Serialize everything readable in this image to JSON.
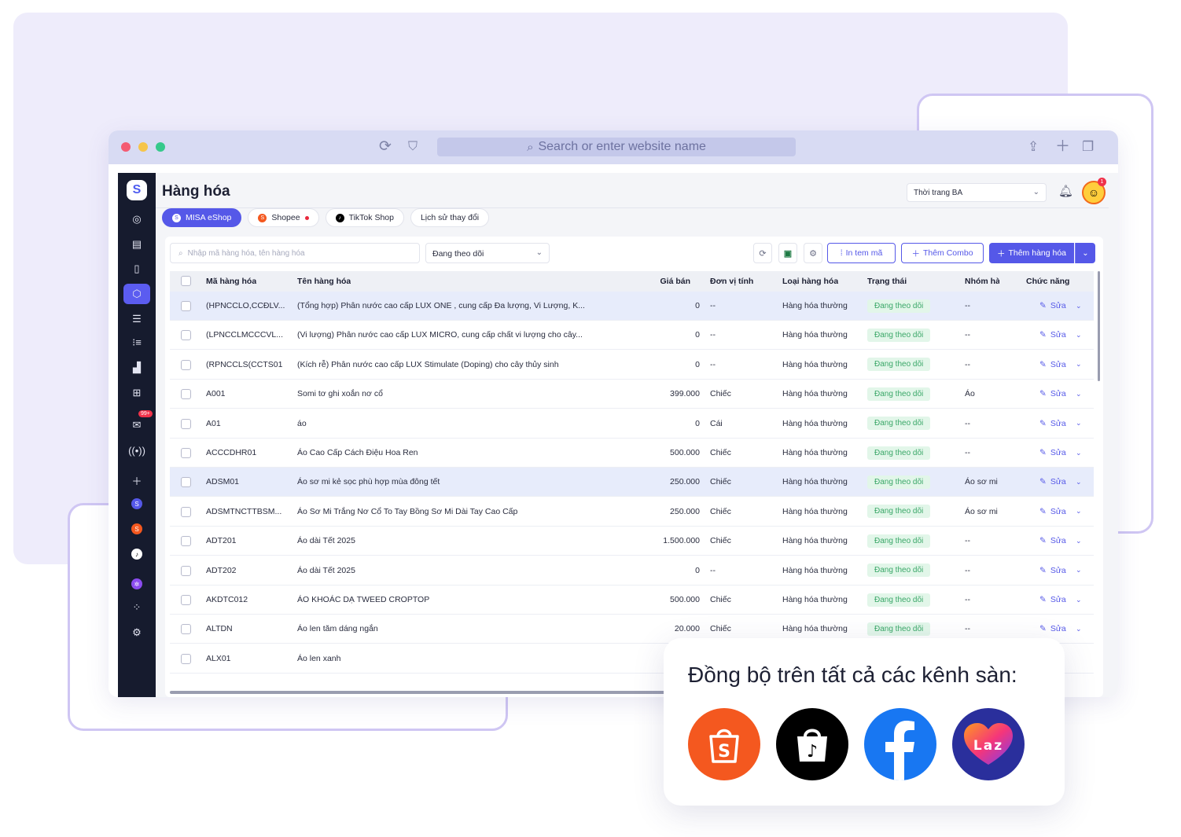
{
  "browser": {
    "url_placeholder": "Search or enter website name",
    "reload_icon": "reload-icon",
    "shield_icon": "shield-icon",
    "share_icon": "share-icon",
    "new_tab_icon": "plus-icon",
    "tabs_icon": "tabs-icon"
  },
  "header": {
    "title": "Hàng hóa",
    "shop_select": "Thời trang BA",
    "avatar_badge": "1"
  },
  "sidebar": {
    "logo_letter": "S",
    "message_badge": "99+"
  },
  "tabs": [
    {
      "label": "MISA eShop",
      "active": true
    },
    {
      "label": "Shopee",
      "active": false
    },
    {
      "label": "TikTok Shop",
      "active": false
    },
    {
      "label": "Lịch sử thay đổi",
      "active": false
    }
  ],
  "toolbar": {
    "search_placeholder": "Nhập mã hàng hóa, tên hàng hóa",
    "follow_filter": "Đang theo dõi",
    "print_label": "In tem mã",
    "combo_label": "Thêm Combo",
    "add_label": "Thêm hàng hóa"
  },
  "table": {
    "headers": {
      "code": "Mã hàng hóa",
      "name": "Tên hàng hóa",
      "price": "Giá bán",
      "unit": "Đơn vị tính",
      "type": "Loại hàng hóa",
      "status": "Trạng thái",
      "group": "Nhóm hà",
      "actions": "Chức năng"
    },
    "edit_label": "Sửa",
    "rows": [
      {
        "code": "(HPNCCLO,CCĐLV...",
        "name": "(Tổng hợp) Phân nước cao cấp LUX ONE , cung cấp Đa lượng, Vi Lượng, K...",
        "price": "0",
        "unit": "--",
        "type": "Hàng hóa thường",
        "status": "Đang theo dõi",
        "group": "--",
        "highlight": true
      },
      {
        "code": "(LPNCCLMCCCVL...",
        "name": "(Vi lượng) Phân nước cao cấp LUX MICRO, cung cấp chất vi lượng cho cây...",
        "price": "0",
        "unit": "--",
        "type": "Hàng hóa thường",
        "status": "Đang theo dõi",
        "group": "--",
        "highlight": false
      },
      {
        "code": "(RPNCCLS(CCTS01",
        "name": "(Kích rễ) Phân nước cao cấp LUX Stimulate (Doping) cho cây thủy sinh",
        "price": "0",
        "unit": "--",
        "type": "Hàng hóa thường",
        "status": "Đang theo dõi",
        "group": "--",
        "highlight": false
      },
      {
        "code": "A001",
        "name": "Somi tơ ghi xoắn nơ cổ",
        "price": "399.000",
        "unit": "Chiếc",
        "type": "Hàng hóa thường",
        "status": "Đang theo dõi",
        "group": "Áo",
        "highlight": false
      },
      {
        "code": "A01",
        "name": "áo",
        "price": "0",
        "unit": "Cái",
        "type": "Hàng hóa thường",
        "status": "Đang theo dõi",
        "group": "--",
        "highlight": false
      },
      {
        "code": "ACCCDHR01",
        "name": "Áo Cao Cấp Cách Điệu Hoa Ren",
        "price": "500.000",
        "unit": "Chiếc",
        "type": "Hàng hóa thường",
        "status": "Đang theo dõi",
        "group": "--",
        "highlight": false
      },
      {
        "code": "ADSM01",
        "name": "Áo sơ mi kẻ sọc phù hợp mùa đông tết",
        "price": "250.000",
        "unit": "Chiếc",
        "type": "Hàng hóa thường",
        "status": "Đang theo dõi",
        "group": "Áo sơ mi",
        "highlight": true
      },
      {
        "code": "ADSMTNCTTBSM...",
        "name": "Áo Sơ Mi Trắng Nơ Cổ To Tay Bồng Sơ Mi Dài Tay Cao Cấp",
        "price": "250.000",
        "unit": "Chiếc",
        "type": "Hàng hóa thường",
        "status": "Đang theo dõi",
        "group": "Áo sơ mi",
        "highlight": false
      },
      {
        "code": "ADT201",
        "name": "Áo dài Tết 2025",
        "price": "1.500.000",
        "unit": "Chiếc",
        "type": "Hàng hóa thường",
        "status": "Đang theo dõi",
        "group": "--",
        "highlight": false
      },
      {
        "code": "ADT202",
        "name": "Áo dài Tết 2025",
        "price": "0",
        "unit": "--",
        "type": "Hàng hóa thường",
        "status": "Đang theo dõi",
        "group": "--",
        "highlight": false
      },
      {
        "code": "AKDTC012",
        "name": "ÁO KHOÁC DẠ TWEED CROPTOP",
        "price": "500.000",
        "unit": "Chiếc",
        "type": "Hàng hóa thường",
        "status": "Đang theo dõi",
        "group": "--",
        "highlight": false
      },
      {
        "code": "ALTDN",
        "name": "Áo len tăm dáng ngắn",
        "price": "20.000",
        "unit": "Chiếc",
        "type": "Hàng hóa thường",
        "status": "Đang theo dõi",
        "group": "--",
        "highlight": false
      },
      {
        "code": "ALX01",
        "name": "Áo len xanh",
        "price": "",
        "unit": "",
        "type": "",
        "status": "",
        "group": "",
        "highlight": false
      }
    ]
  },
  "overlay": {
    "title": "Đồng bộ trên tất cả các kênh sàn:",
    "lazada_text": "Laz",
    "channels": [
      {
        "icon": "shopee-icon",
        "color": "#f4581f"
      },
      {
        "icon": "tiktok-icon",
        "color": "#000000"
      },
      {
        "icon": "facebook-icon",
        "color": "#1877f2"
      },
      {
        "icon": "lazada-icon",
        "color": "#2a2f9c"
      }
    ]
  },
  "colors": {
    "accent": "#5558e8",
    "sidebar": "#161b2e",
    "status_bg": "#e2f6e9",
    "status_fg": "#3aa768"
  }
}
